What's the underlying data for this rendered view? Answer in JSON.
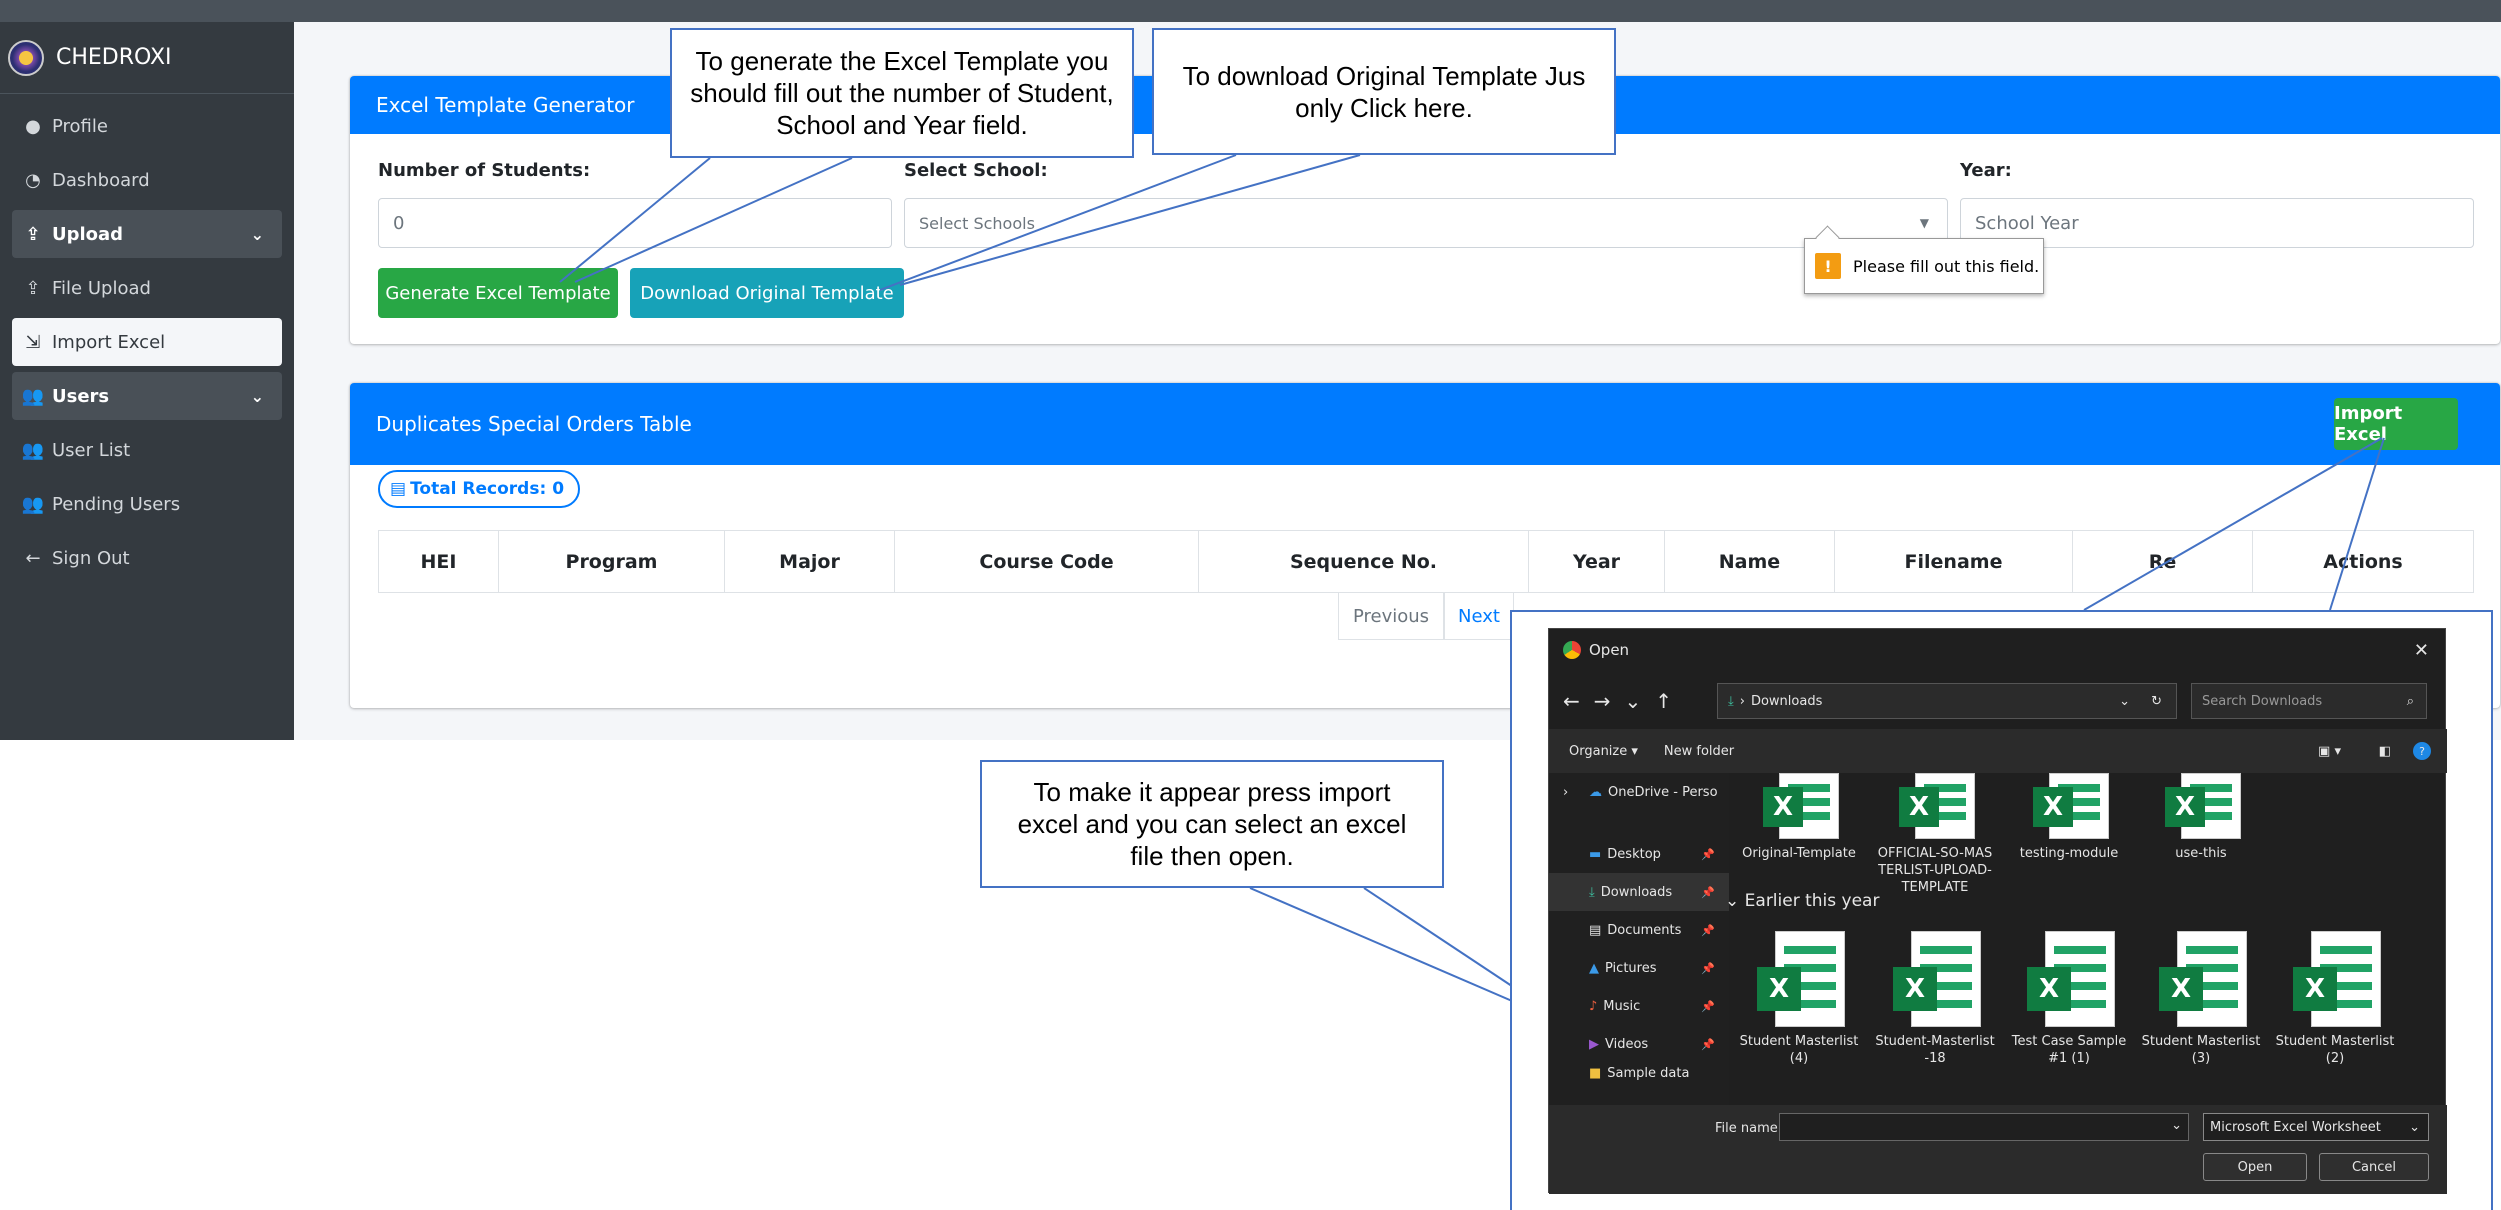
{
  "sidebar": {
    "brand": "CHEDROXI",
    "items": [
      {
        "icon": "user-icon",
        "label": "Profile"
      },
      {
        "icon": "dashboard-icon",
        "label": "Dashboard"
      },
      {
        "icon": "upload-icon",
        "label": "Upload"
      },
      {
        "icon": "upload-icon",
        "label": "File Upload"
      },
      {
        "icon": "import-icon",
        "label": "Import Excel"
      },
      {
        "icon": "users-icon",
        "label": "Users"
      },
      {
        "icon": "users-icon",
        "label": "User List"
      },
      {
        "icon": "users-icon",
        "label": "Pending Users"
      },
      {
        "icon": "arrow-left-icon",
        "label": "Sign Out"
      }
    ]
  },
  "generator": {
    "title": "Excel Template Generator",
    "students_label": "Number of Students:",
    "students_value": "0",
    "school_label": "Select School:",
    "school_placeholder": "Select Schools",
    "year_label": "Year:",
    "year_placeholder": "School Year",
    "generate_btn": "Generate Excel Template",
    "download_btn": "Download Original Template",
    "validation_msg": "Please fill out this field."
  },
  "duplicates": {
    "title": "Duplicates Special Orders Table",
    "import_btn": "Import Excel",
    "total_records": "Total Records: 0",
    "columns": [
      "HEI",
      "Program",
      "Major",
      "Course Code",
      "Sequence No.",
      "Year",
      "Name",
      "Filename",
      "Re",
      "Actions"
    ],
    "prev": "Previous",
    "next": "Next"
  },
  "callouts": {
    "generate": "To generate the Excel Template you should fill out the number of Student, School and Year field.",
    "download": "To download Original Template Jus only Click here.",
    "import": "To make it appear press import excel and you can select an excel file then open."
  },
  "dialog": {
    "title": "Open",
    "address": "Downloads",
    "search_placeholder": "Search Downloads",
    "organize": "Organize ▾",
    "new_folder": "New folder",
    "tree": [
      "OneDrive - Perso",
      "Desktop",
      "Downloads",
      "Documents",
      "Pictures",
      "Music",
      "Videos",
      "Sample data"
    ],
    "recent_files": [
      "Original-Template",
      "OFFICIAL-SO-MASTERLIST-UPLOAD-TEMPLATE",
      "testing-module",
      "use-this"
    ],
    "earlier_label": "Earlier this year",
    "earlier_files": [
      "Student Masterlist (4)",
      "Student-Masterlist-18",
      "Test Case Sample #1 (1)",
      "Student Masterlist (3)",
      "Student Masterlist (2)"
    ],
    "filename_label": "File name:",
    "filetype": "Microsoft Excel Worksheet",
    "open_btn": "Open",
    "cancel_btn": "Cancel"
  },
  "colors": {
    "primary": "#007bff",
    "success": "#28a745",
    "info": "#17a2b8",
    "sidebar": "#343a40",
    "callout_border": "#4472c4"
  }
}
